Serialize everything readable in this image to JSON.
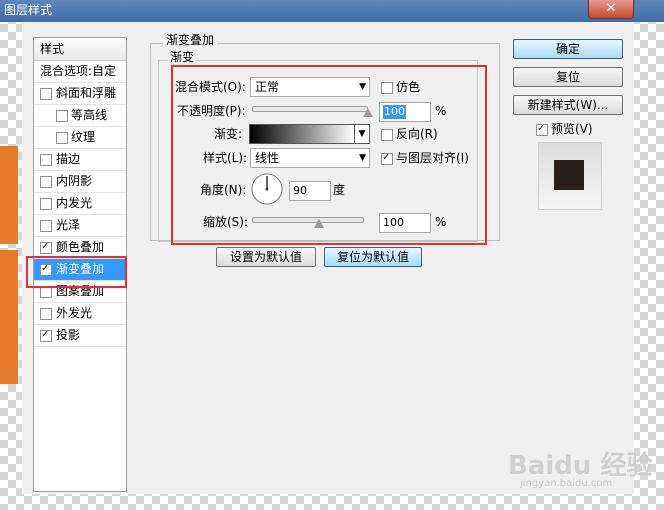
{
  "window": {
    "title": "图层样式",
    "close_glyph": "✕"
  },
  "styles_panel": {
    "header": "样式",
    "blend_options": "混合选项:自定",
    "items": [
      {
        "label": "斜面和浮雕",
        "checked": false
      },
      {
        "label": "等高线",
        "checked": false
      },
      {
        "label": "纹理",
        "checked": false
      },
      {
        "label": "描边",
        "checked": false
      },
      {
        "label": "内阴影",
        "checked": false
      },
      {
        "label": "内发光",
        "checked": false
      },
      {
        "label": "光泽",
        "checked": false
      },
      {
        "label": "颜色叠加",
        "checked": true
      },
      {
        "label": "渐变叠加",
        "checked": true,
        "selected": true
      },
      {
        "label": "图案叠加",
        "checked": false
      },
      {
        "label": "外发光",
        "checked": false
      },
      {
        "label": "投影",
        "checked": true
      }
    ]
  },
  "gradient_overlay": {
    "group_title": "渐变叠加",
    "sub_title": "渐变",
    "blend_mode_label": "混合模式(O):",
    "blend_mode_value": "正常",
    "dither_label": "仿色",
    "opacity_label": "不透明度(P):",
    "opacity_value": "100",
    "percent": "%",
    "gradient_label": "渐变:",
    "reverse_label": "反向(R)",
    "style_label": "样式(L):",
    "style_value": "线性",
    "align_label": "与图层对齐(I)",
    "angle_label": "角度(N):",
    "angle_value": "90",
    "degree": "度",
    "scale_label": "缩放(S):",
    "scale_value": "100",
    "opacity_fraction": 1.0,
    "scale_fraction": 0.6,
    "make_default": "设置为默认值",
    "reset_default": "复位为默认值",
    "dropdown_arrow": "▼"
  },
  "actions": {
    "ok": "确定",
    "reset": "复位",
    "new_style": "新建样式(W)...",
    "preview": "预览(V)"
  },
  "watermark": {
    "text": "Baidu 经验",
    "url": "jingyan.baidu.com"
  },
  "colors": {
    "selection": "#3399ff",
    "highlight_box": "#e03030",
    "preview_swatch": "#2a1f1f"
  }
}
